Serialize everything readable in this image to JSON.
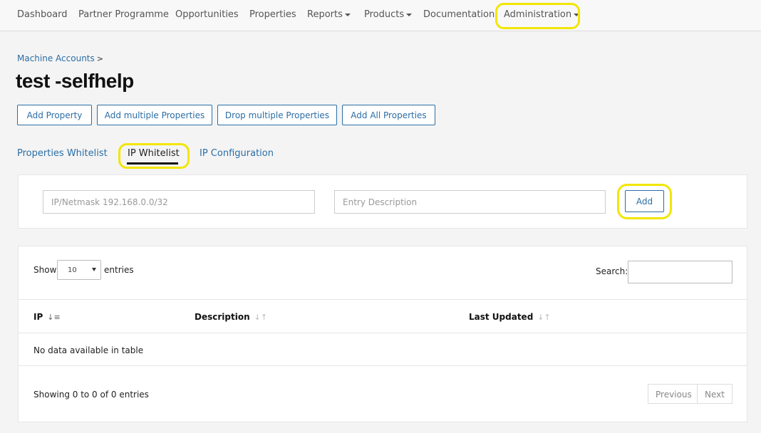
{
  "nav": {
    "dashboard": "Dashboard",
    "partner_programme": "Partner Programme",
    "opportunities": "Opportunities",
    "properties": "Properties",
    "reports": "Reports",
    "products": "Products",
    "documentation": "Documentation",
    "administration": "Administration"
  },
  "breadcrumb": {
    "parent": "Machine Accounts",
    "separator": ">"
  },
  "page_title": "test -selfhelp",
  "actions": {
    "add_property": "Add Property",
    "add_multiple": "Add multiple Properties",
    "drop_multiple": "Drop multiple Properties",
    "add_all": "Add All Properties"
  },
  "tabs": {
    "properties_whitelist": "Properties Whitelist",
    "ip_whitelist": "IP Whitelist",
    "ip_configuration": "IP Configuration"
  },
  "form": {
    "ip_placeholder": "IP/Netmask 192.168.0.0/32",
    "description_placeholder": "Entry Description",
    "add_label": "Add"
  },
  "table": {
    "show_label": "Show",
    "entries_label": "entries",
    "page_size": "10",
    "search_label": "Search:",
    "columns": {
      "ip": "IP",
      "description": "Description",
      "last_updated": "Last Updated"
    },
    "empty_message": "No data available in table",
    "info": "Showing 0 to 0 of 0 entries",
    "previous_label": "Previous",
    "next_label": "Next"
  },
  "colors": {
    "link": "#2b6ea5",
    "highlight": "#f2e600"
  }
}
